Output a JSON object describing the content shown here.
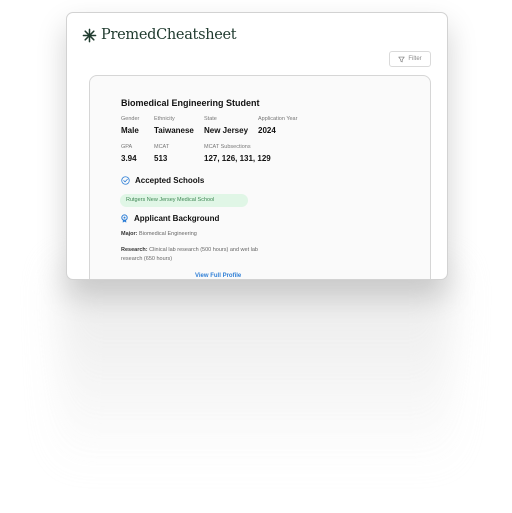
{
  "app": {
    "name": "PremedCheatsheet"
  },
  "toolbar": {
    "filter_label": "Filter"
  },
  "profile": {
    "title": "Biomedical Engineering Student",
    "fields_row1": [
      {
        "label": "Gender",
        "value": "Male"
      },
      {
        "label": "Ethnicity",
        "value": "Taiwanese"
      },
      {
        "label": "State",
        "value": "New Jersey"
      },
      {
        "label": "Application Year",
        "value": "2024"
      }
    ],
    "fields_row2": [
      {
        "label": "GPA",
        "value": "3.94"
      },
      {
        "label": "MCAT",
        "value": "513"
      },
      {
        "label": "MCAT Subsections",
        "value": "127, 126, 131, 129"
      }
    ],
    "accepted_heading": "Accepted Schools",
    "accepted_schools": [
      "Rutgers New Jersey Medical School"
    ],
    "background_heading": "Applicant Background",
    "major_label": "Major:",
    "major_value": "Biomedical Engineering",
    "research_label": "Research:",
    "research_value": "Clinical lab research (500 hours) and wet lab",
    "research_value_cont": "research (650 hours)",
    "view_profile_label": "View Full Profile"
  },
  "colors": {
    "brand": "#1f3a2e",
    "accent_link": "#2f7fd6",
    "chip_bg": "#e0f6e6",
    "chip_text": "#3d8653"
  },
  "icons": [
    "asterisk-logo-icon",
    "filter-icon",
    "check-circle-icon",
    "award-icon"
  ]
}
